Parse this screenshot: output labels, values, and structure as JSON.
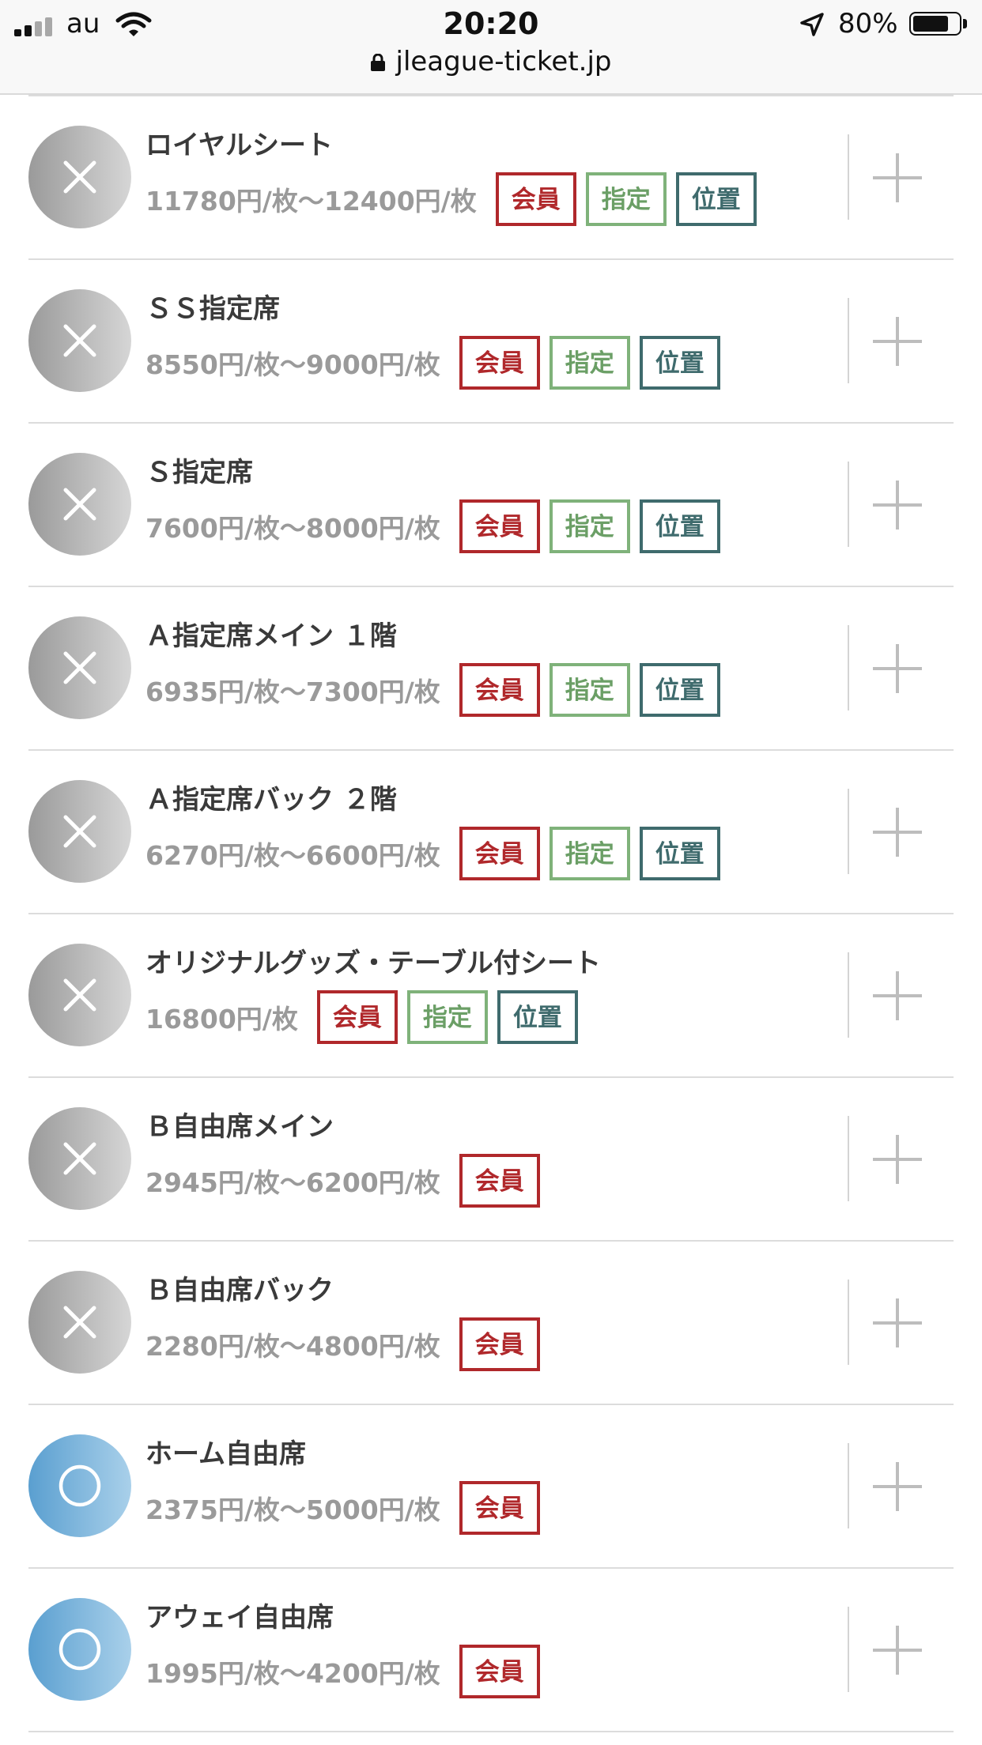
{
  "status_bar": {
    "carrier": "au",
    "time": "20:20",
    "battery": "80%",
    "battery_level": 0.8,
    "url": "jleague-ticket.jp"
  },
  "tag_labels": {
    "member": "会員",
    "reserved": "指定",
    "position": "位置"
  },
  "colors": {
    "member": "#b0282b",
    "reserved": "#7fb27a",
    "position": "#3f6b6d",
    "available": "#6aa8d6",
    "unavailable": "#b5b5b5"
  },
  "icons": {
    "sold_out": "x-icon",
    "available": "circle-icon",
    "add": "plus-icon"
  },
  "seats": [
    {
      "name": "ロイヤルシート",
      "price": "11780円/枚〜12400円/枚",
      "available": false,
      "tags": [
        "member",
        "reserved",
        "position"
      ]
    },
    {
      "name": "ＳＳ指定席",
      "price": "8550円/枚〜9000円/枚",
      "available": false,
      "tags": [
        "member",
        "reserved",
        "position"
      ]
    },
    {
      "name": "Ｓ指定席",
      "price": "7600円/枚〜8000円/枚",
      "available": false,
      "tags": [
        "member",
        "reserved",
        "position"
      ]
    },
    {
      "name": "Ａ指定席メイン １階",
      "price": "6935円/枚〜7300円/枚",
      "available": false,
      "tags": [
        "member",
        "reserved",
        "position"
      ]
    },
    {
      "name": "Ａ指定席バック ２階",
      "price": "6270円/枚〜6600円/枚",
      "available": false,
      "tags": [
        "member",
        "reserved",
        "position"
      ]
    },
    {
      "name": "オリジナルグッズ・テーブル付シート",
      "price": "16800円/枚",
      "available": false,
      "tags": [
        "member",
        "reserved",
        "position"
      ]
    },
    {
      "name": "Ｂ自由席メイン",
      "price": "2945円/枚〜6200円/枚",
      "available": false,
      "tags": [
        "member"
      ]
    },
    {
      "name": "Ｂ自由席バック",
      "price": "2280円/枚〜4800円/枚",
      "available": false,
      "tags": [
        "member"
      ]
    },
    {
      "name": "ホーム自由席",
      "price": "2375円/枚〜5000円/枚",
      "available": true,
      "tags": [
        "member"
      ]
    },
    {
      "name": "アウェイ自由席",
      "price": "1995円/枚〜4200円/枚",
      "available": true,
      "tags": [
        "member"
      ]
    }
  ]
}
